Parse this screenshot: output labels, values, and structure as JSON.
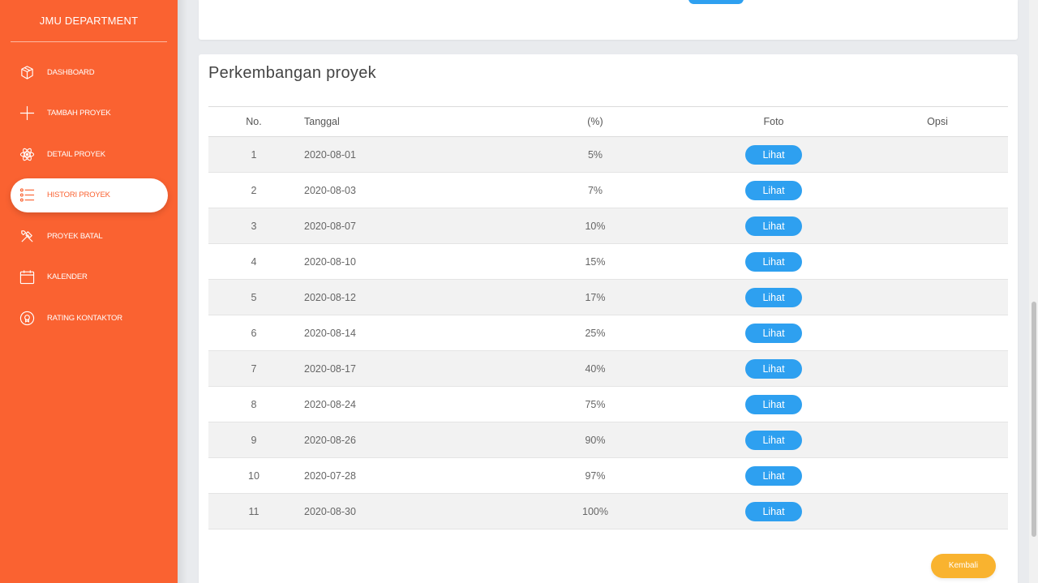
{
  "sidebar": {
    "brand": "JMU DEPARTMENT",
    "items": [
      {
        "label": "DASHBOARD",
        "icon": "cube-icon",
        "active": false
      },
      {
        "label": "TAMBAH PROYEK",
        "icon": "plus-icon",
        "active": false
      },
      {
        "label": "DETAIL PROYEK",
        "icon": "atom-icon",
        "active": false
      },
      {
        "label": "HISTORI PROYEK",
        "icon": "list-icon",
        "active": true
      },
      {
        "label": "PROYEK BATAL",
        "icon": "tools-icon",
        "active": false
      },
      {
        "label": "KALENDER",
        "icon": "calendar-icon",
        "active": false
      },
      {
        "label": "RATING KONTAKTOR",
        "icon": "badge-icon",
        "active": false
      }
    ]
  },
  "main": {
    "title": "Perkembangan proyek",
    "table": {
      "headers": [
        "No.",
        "Tanggal",
        "(%)",
        "Foto",
        "Opsi"
      ],
      "rows": [
        {
          "no": "1",
          "tanggal": "2020-08-01",
          "persen": "5%",
          "foto": "Lihat"
        },
        {
          "no": "2",
          "tanggal": "2020-08-03",
          "persen": "7%",
          "foto": "Lihat"
        },
        {
          "no": "3",
          "tanggal": "2020-08-07",
          "persen": "10%",
          "foto": "Lihat"
        },
        {
          "no": "4",
          "tanggal": "2020-08-10",
          "persen": "15%",
          "foto": "Lihat"
        },
        {
          "no": "5",
          "tanggal": "2020-08-12",
          "persen": "17%",
          "foto": "Lihat"
        },
        {
          "no": "6",
          "tanggal": "2020-08-14",
          "persen": "25%",
          "foto": "Lihat"
        },
        {
          "no": "7",
          "tanggal": "2020-08-17",
          "persen": "40%",
          "foto": "Lihat"
        },
        {
          "no": "8",
          "tanggal": "2020-08-24",
          "persen": "75%",
          "foto": "Lihat"
        },
        {
          "no": "9",
          "tanggal": "2020-08-26",
          "persen": "90%",
          "foto": "Lihat"
        },
        {
          "no": "10",
          "tanggal": "2020-07-28",
          "persen": "97%",
          "foto": "Lihat"
        },
        {
          "no": "11",
          "tanggal": "2020-08-30",
          "persen": "100%",
          "foto": "Lihat"
        }
      ]
    },
    "back_label": "Kembali"
  },
  "colors": {
    "sidebar": "#fa6231",
    "lihat_button": "#2ea0f0",
    "kembali_button": "#f9b32f"
  }
}
